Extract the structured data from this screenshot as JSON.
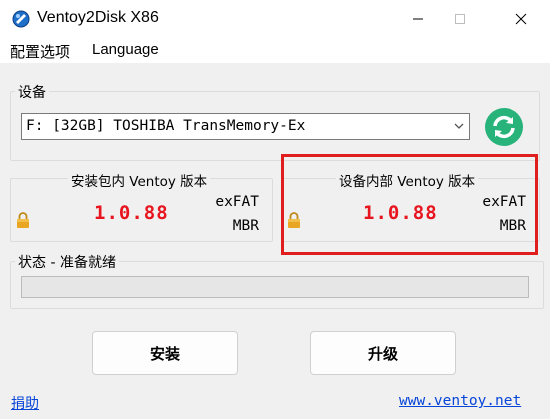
{
  "window": {
    "title": "Ventoy2Disk  X86",
    "icon": "ventoy-app-icon",
    "controls": [
      "minimize-icon",
      "maximize-icon",
      "close-icon"
    ]
  },
  "menu": {
    "options": "配置选项",
    "language": "Language"
  },
  "device": {
    "group_label": "设备",
    "selected": "F: [32GB] TOSHIBA TransMemory-Ex",
    "refresh_icon": "refresh-icon"
  },
  "package_panel": {
    "title": "安装包内 Ventoy 版本",
    "version": "1.0.88",
    "fs": "exFAT",
    "partition": "MBR"
  },
  "device_panel": {
    "title": "设备内部 Ventoy 版本",
    "version": "1.0.88",
    "fs": "exFAT",
    "partition": "MBR"
  },
  "status": {
    "label": "状态 - 准备就绪",
    "progress": 0
  },
  "buttons": {
    "install": "安装",
    "update": "升级"
  },
  "footer": {
    "donate": "捐助",
    "website": "www.ventoy.net"
  },
  "colors": {
    "version_red": "#e8141e",
    "highlight_red": "#e01e1e",
    "link_blue": "#0645d8",
    "refresh_green": "#27b37a"
  }
}
